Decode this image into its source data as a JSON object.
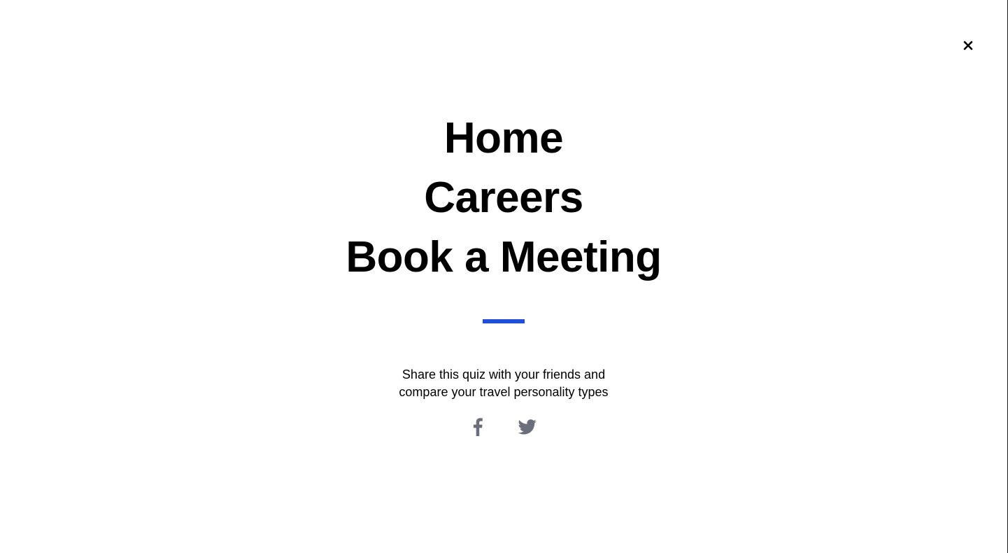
{
  "menu": {
    "close_icon": "close-icon",
    "links": [
      {
        "label": "Home"
      },
      {
        "label": "Careers"
      },
      {
        "label": "Book a Meeting"
      }
    ]
  },
  "share": {
    "line1": "Share this quiz with your friends and",
    "line2": "compare your travel personality types",
    "icons": [
      "facebook-icon",
      "twitter-icon"
    ]
  },
  "colors": {
    "accent": "#1f4fd8",
    "icon_gray": "#6b6f7b",
    "text": "#000000",
    "background": "#ffffff"
  }
}
